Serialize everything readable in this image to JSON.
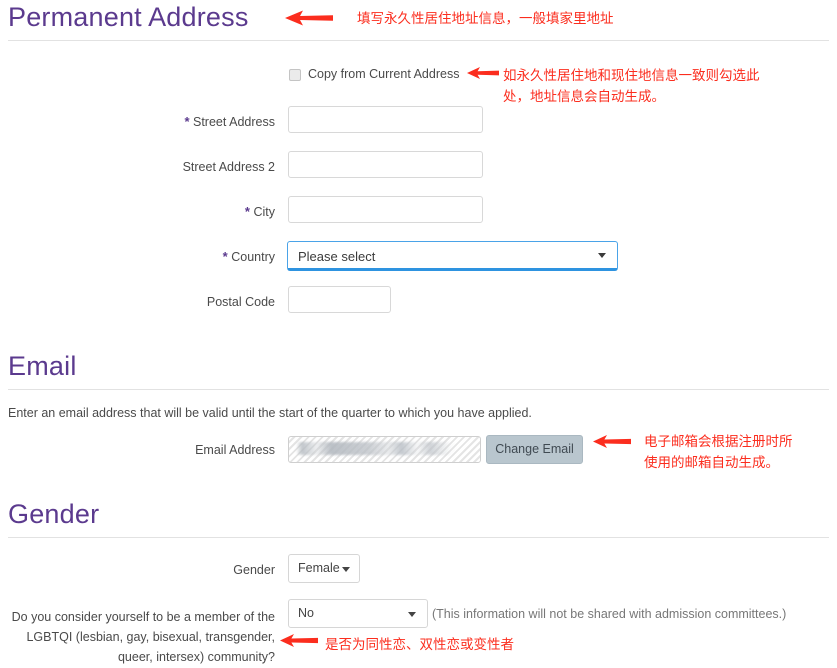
{
  "sections": {
    "permanent_address": {
      "heading": "Permanent Address",
      "copy_checkbox_label": "Copy from Current Address",
      "fields": [
        {
          "label": "Street Address",
          "required": true,
          "value": ""
        },
        {
          "label": "Street Address 2",
          "required": false,
          "value": ""
        },
        {
          "label": "City",
          "required": true,
          "value": ""
        },
        {
          "label": "Country",
          "required": true,
          "value": "Please select"
        },
        {
          "label": "Postal Code",
          "required": false,
          "value": ""
        }
      ]
    },
    "email": {
      "heading": "Email",
      "helper_text": "Enter an email address that will be valid until the start of the quarter to which you have applied.",
      "field_label": "Email Address",
      "field_value": "",
      "change_button_label": "Change Email"
    },
    "gender": {
      "heading": "Gender",
      "gender_label": "Gender",
      "gender_value": "Female",
      "lgbtqi_question": "Do you consider yourself to be a member of the LGBTQI (lesbian, gay, bisexual, transgender, queer, intersex) community?",
      "lgbtqi_value": "No",
      "lgbtqi_note": "(This information will not be shared with admission committees.)"
    }
  },
  "annotations": [
    {
      "id": "ann-permanent",
      "text": "填写永久性居住地址信息，一般填家里地址"
    },
    {
      "id": "ann-copy",
      "text": "如永久性居住地和现住地信息一致则勾选此\n处，地址信息会自动生成。"
    },
    {
      "id": "ann-email",
      "text": "电子邮箱会根据注册时所\n使用的邮箱自动生成。"
    },
    {
      "id": "ann-lgbtqi",
      "text": "是否为同性恋、双性恋或变性者"
    }
  ],
  "colors": {
    "heading_purple": "#5b3a8e",
    "annotation_red": "#fb2d1e",
    "focus_blue": "#2e93e0",
    "button_gray": "#b9c6ce"
  }
}
